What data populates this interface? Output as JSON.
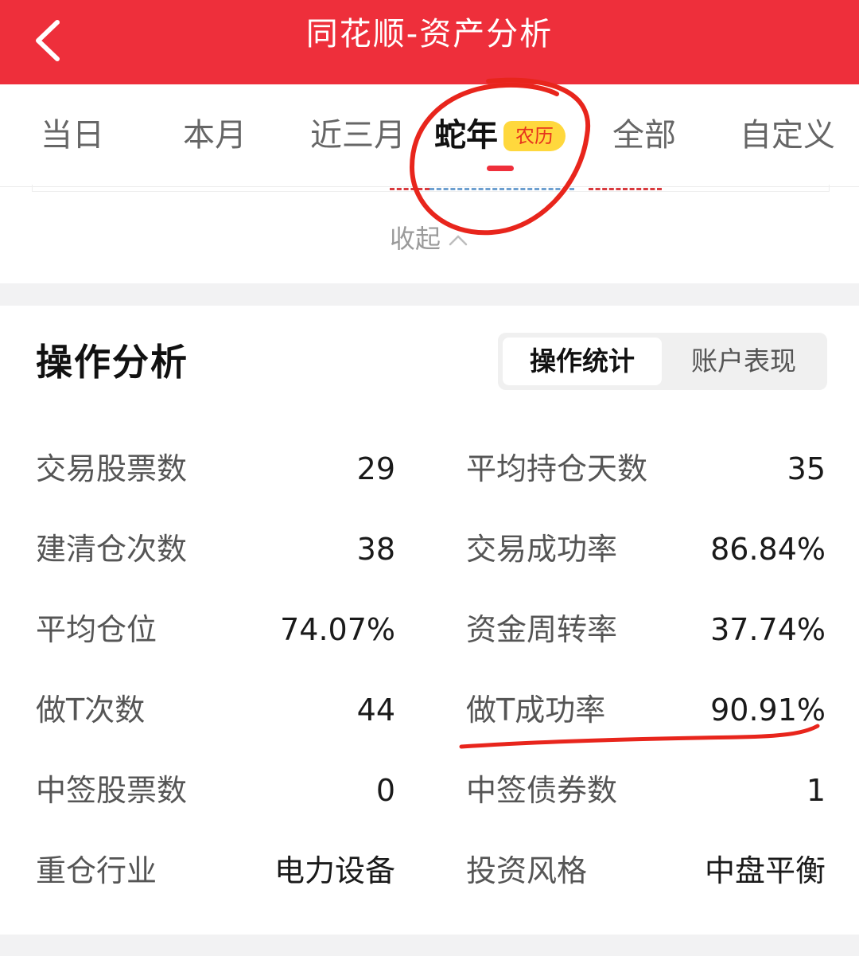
{
  "header": {
    "back_icon": "chevron-left-icon",
    "title": "同花顺-资产分析",
    "background": "#ee2f3b"
  },
  "tabs": {
    "items": [
      {
        "label": "当日"
      },
      {
        "label": "本月"
      },
      {
        "label": "近三月"
      },
      {
        "label": "蛇年",
        "badge": "农历",
        "active": true
      },
      {
        "label": "全部"
      },
      {
        "label": "自定义"
      }
    ],
    "active_color": "#ef2f3b",
    "badge_color": "#ffd83d"
  },
  "collapse": {
    "label": "收起",
    "icon": "chevron-up-icon"
  },
  "operation_analysis": {
    "title": "操作分析",
    "segments": [
      {
        "label": "操作统计",
        "selected": true
      },
      {
        "label": "账户表现",
        "selected": false
      }
    ],
    "stats": [
      {
        "label": "交易股票数",
        "value": "29"
      },
      {
        "label": "平均持仓天数",
        "value": "35"
      },
      {
        "label": "建清仓次数",
        "value": "38"
      },
      {
        "label": "交易成功率",
        "value": "86.84%"
      },
      {
        "label": "平均仓位",
        "value": "74.07%"
      },
      {
        "label": "资金周转率",
        "value": "37.74%"
      },
      {
        "label": "做T次数",
        "value": "44"
      },
      {
        "label": "做T成功率",
        "value": "90.91%"
      },
      {
        "label": "中签股票数",
        "value": "0"
      },
      {
        "label": "中签债券数",
        "value": "1"
      },
      {
        "label": "重仓行业",
        "value": "电力设备"
      },
      {
        "label": "投资风格",
        "value": "中盘平衡"
      }
    ]
  },
  "annotations": {
    "color": "#e8251c"
  }
}
